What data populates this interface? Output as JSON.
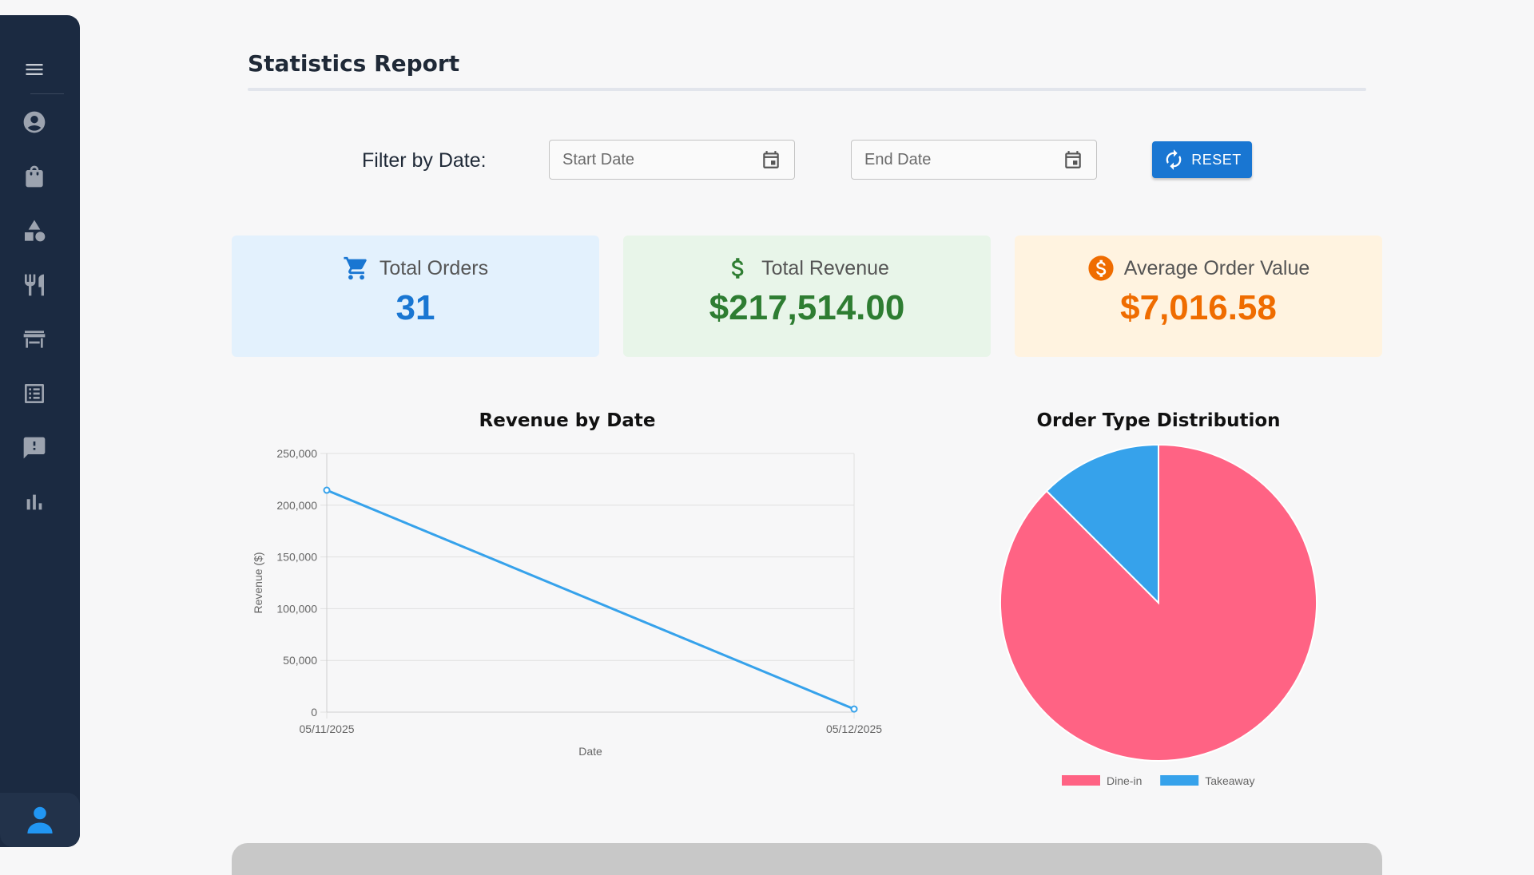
{
  "sidebar": {
    "items": [
      {
        "icon": "menu-icon"
      },
      {
        "icon": "account-circle-icon"
      },
      {
        "icon": "shopping-bag-icon"
      },
      {
        "icon": "category-shapes-icon"
      },
      {
        "icon": "restaurant-icon"
      },
      {
        "icon": "table-icon"
      },
      {
        "icon": "list-alt-icon"
      },
      {
        "icon": "feedback-icon"
      },
      {
        "icon": "bar-chart-icon"
      }
    ],
    "user_icon": "person-icon"
  },
  "header": {
    "title": "Statistics Report"
  },
  "filter": {
    "label": "Filter by Date:",
    "start_placeholder": "Start Date",
    "end_placeholder": "End Date",
    "reset_label": "RESET"
  },
  "cards": {
    "orders": {
      "label": "Total Orders",
      "value": "31",
      "color": "#1976d2"
    },
    "revenue": {
      "label": "Total Revenue",
      "value": "$217,514.00",
      "color": "#2e7d32"
    },
    "avg": {
      "label": "Average Order Value",
      "value": "$7,016.58",
      "color": "#ef6c00"
    }
  },
  "chart_data": [
    {
      "type": "line",
      "title": "Revenue by Date",
      "xlabel": "Date",
      "ylabel": "Revenue ($)",
      "x": [
        "05/11/2025",
        "05/12/2025"
      ],
      "series": [
        {
          "values": [
            214500,
            3000
          ],
          "color": "#36a2eb"
        }
      ],
      "ylim": [
        0,
        250000
      ],
      "yticks": [
        "0",
        "50,000",
        "100,000",
        "150,000",
        "200,000",
        "250,000"
      ],
      "ytick_values": [
        0,
        50000,
        100000,
        150000,
        200000,
        250000
      ],
      "grid": true
    },
    {
      "type": "pie",
      "title": "Order Type Distribution",
      "categories": [
        "Dine-in",
        "Takeaway"
      ],
      "values": [
        87.5,
        12.5
      ],
      "colors": [
        "#ff6384",
        "#36a2eb"
      ],
      "legend": "bottom"
    }
  ]
}
